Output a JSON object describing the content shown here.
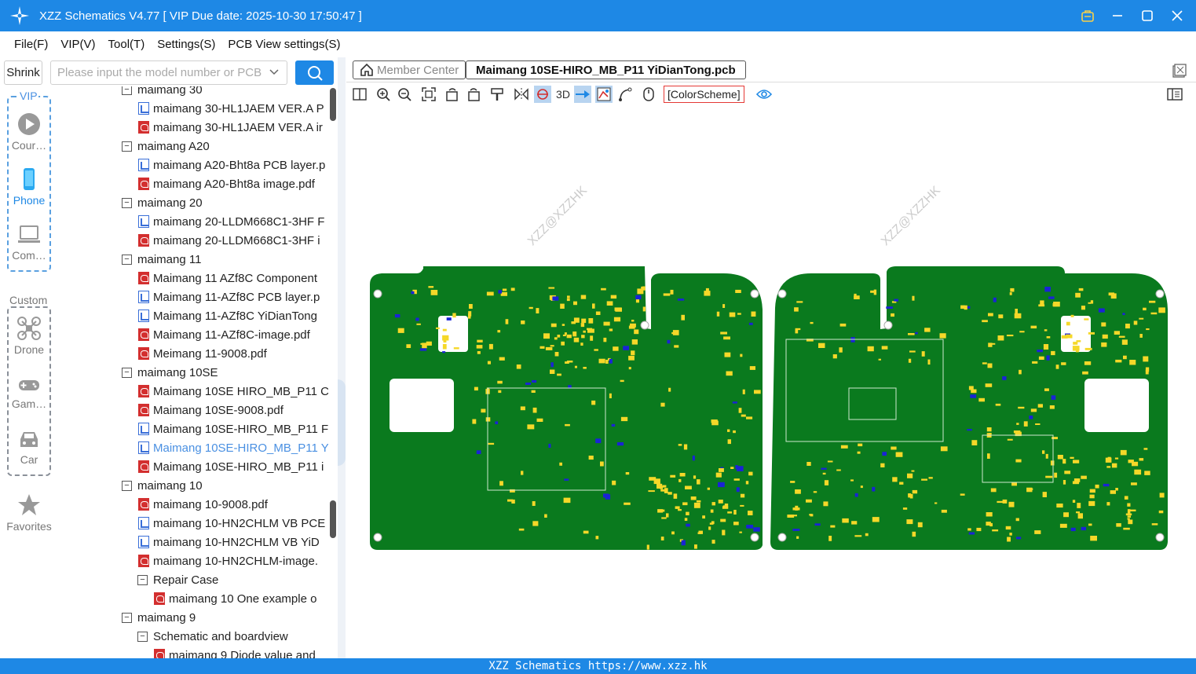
{
  "window": {
    "title": "XZZ Schematics V4.77 [ VIP Due date: 2025-10-30 17:50:47 ]"
  },
  "menu": [
    "File(F)",
    "VIP(V)",
    "Tool(T)",
    "Settings(S)",
    "PCB View settings(S)"
  ],
  "search": {
    "shrink_label": "Shrink",
    "placeholder": "Please input the model number or PCB"
  },
  "sidebar": {
    "vip_group": "VIP",
    "custom_group": "Custom",
    "items": [
      {
        "label": "Cour…",
        "icon": "play-circle-icon"
      },
      {
        "label": "Phone",
        "icon": "phone-icon"
      },
      {
        "label": "Com…",
        "icon": "laptop-icon"
      },
      {
        "label": "Drone",
        "icon": "drone-icon"
      },
      {
        "label": "Gam…",
        "icon": "gamepad-icon"
      },
      {
        "label": "Car",
        "icon": "car-icon"
      },
      {
        "label": "Favorites",
        "icon": "star-icon"
      }
    ]
  },
  "tree": [
    {
      "level": 0,
      "type": "folder",
      "label": "maimang 30"
    },
    {
      "level": 1,
      "type": "pcb",
      "label": "maimang 30-HL1JAEM VER.A P"
    },
    {
      "level": 1,
      "type": "pdf",
      "label": "maimang 30-HL1JAEM VER.A ir"
    },
    {
      "level": 0,
      "type": "folder",
      "label": "maimang A20"
    },
    {
      "level": 1,
      "type": "pcb",
      "label": "maimang A20-Bht8a PCB layer.p"
    },
    {
      "level": 1,
      "type": "pdf",
      "label": "maimang A20-Bht8a image.pdf"
    },
    {
      "level": 0,
      "type": "folder",
      "label": "maimang 20"
    },
    {
      "level": 1,
      "type": "pcb",
      "label": "maimang 20-LLDM668C1-3HF F"
    },
    {
      "level": 1,
      "type": "pdf",
      "label": "maimang 20-LLDM668C1-3HF i"
    },
    {
      "level": 0,
      "type": "folder",
      "label": "maimang 11"
    },
    {
      "level": 1,
      "type": "pdf",
      "label": "Maimang 11 AZf8C Component"
    },
    {
      "level": 1,
      "type": "pcb",
      "label": "Maimang 11-AZf8C PCB layer.p"
    },
    {
      "level": 1,
      "type": "pcb",
      "label": "Maimang 11-AZf8C YiDianTong"
    },
    {
      "level": 1,
      "type": "pdf",
      "label": "Maimang 11-AZf8C-image.pdf"
    },
    {
      "level": 1,
      "type": "pdf",
      "label": "Meimang 11-9008.pdf"
    },
    {
      "level": 0,
      "type": "folder",
      "label": "maimang 10SE"
    },
    {
      "level": 1,
      "type": "pdf",
      "label": "Maimang 10SE HIRO_MB_P11 C"
    },
    {
      "level": 1,
      "type": "pdf",
      "label": "Maimang 10SE-9008.pdf"
    },
    {
      "level": 1,
      "type": "pcb",
      "label": "Maimang 10SE-HIRO_MB_P11 F"
    },
    {
      "level": 1,
      "type": "pcb",
      "label": "Maimang 10SE-HIRO_MB_P11 Y",
      "selected": true
    },
    {
      "level": 1,
      "type": "pdf",
      "label": "Maimang 10SE-HIRO_MB_P11 i"
    },
    {
      "level": 0,
      "type": "folder",
      "label": "maimang 10"
    },
    {
      "level": 1,
      "type": "pdf",
      "label": "maimang 10-9008.pdf"
    },
    {
      "level": 1,
      "type": "pcb",
      "label": "maimang 10-HN2CHLM VB PCE"
    },
    {
      "level": 1,
      "type": "pcb",
      "label": "maimang 10-HN2CHLM VB YiD"
    },
    {
      "level": 1,
      "type": "pdf",
      "label": "maimang 10-HN2CHLM-image."
    },
    {
      "level": 1,
      "type": "folder",
      "label": "Repair Case"
    },
    {
      "level": 2,
      "type": "pdf",
      "label": "maimang 10 One example o"
    },
    {
      "level": 0,
      "type": "folder",
      "label": "maimang 9"
    },
    {
      "level": 1,
      "type": "folder",
      "label": "Schematic and boardview"
    },
    {
      "level": 2,
      "type": "pdf",
      "label": "maimang 9 Diode value and"
    }
  ],
  "tabs": {
    "member": "Member Center",
    "file": "Maimang 10SE-HIRO_MB_P11 YiDianTong.pcb"
  },
  "toolbar": {
    "three_d": "3D",
    "color_scheme": "[ColorScheme]",
    "icons": [
      "split-view-icon",
      "zoom-in-icon",
      "zoom-out-icon",
      "fit-screen-icon",
      "rotate-left-icon",
      "rotate-right-icon",
      "paint-icon",
      "mirror-icon",
      "net-highlight-icon",
      "3d-label",
      "pin-arrow-icon",
      "layer-toggle-icon",
      "trace-icon",
      "mouse-icon",
      "color-scheme",
      "eye-icon"
    ]
  },
  "watermark": "XZZ@XZZHK",
  "status": "XZZ Schematics https://www.xzz.hk",
  "colors": {
    "accent": "#1e88e5",
    "pcb_green": "#0a7a1e",
    "pad_yellow": "#f5d829",
    "via_blue": "#1a23d6"
  }
}
